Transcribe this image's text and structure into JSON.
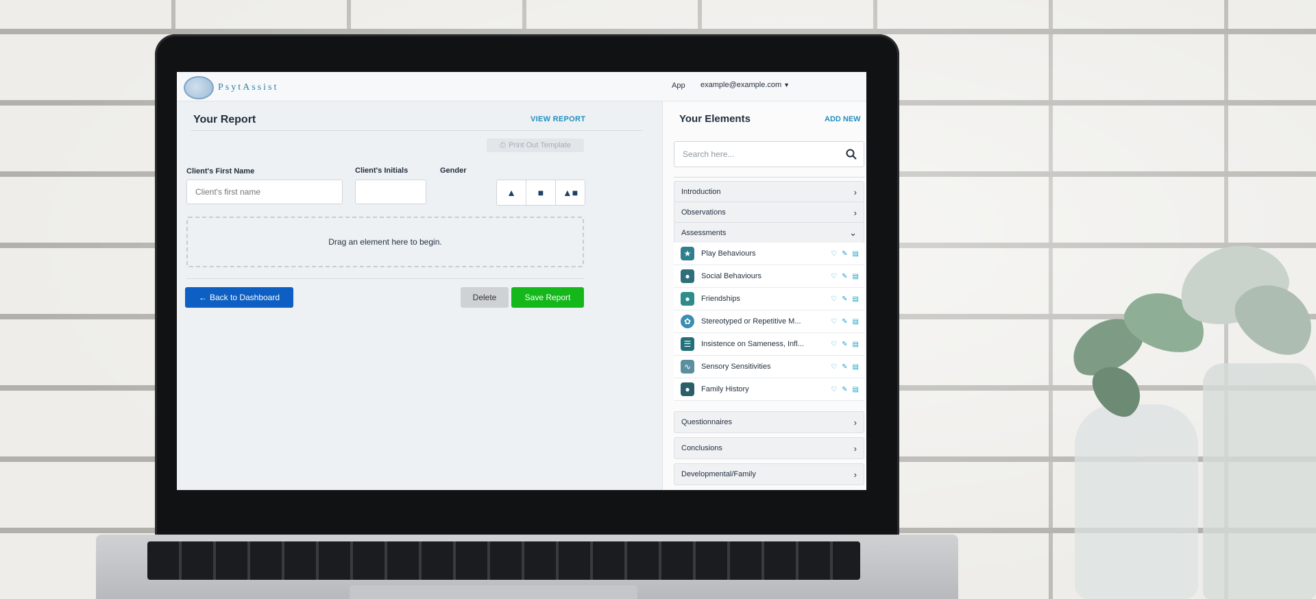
{
  "brand": {
    "name": "PsytAssist"
  },
  "topnav": {
    "app_label": "App",
    "user_email": "example@example.com"
  },
  "report": {
    "title": "Your Report",
    "view_link": "VIEW REPORT",
    "print_label": "Print Out Template",
    "first_name_label": "Client's First Name",
    "first_name_placeholder": "Client's first name",
    "first_name_value": "",
    "initials_label": "Client's Initials",
    "initials_value": "",
    "gender_label": "Gender",
    "gender_options": [
      "male",
      "female",
      "other"
    ],
    "dropzone_text": "Drag an element here to begin.",
    "back_label": "Back to Dashboard",
    "delete_label": "Delete",
    "save_label": "Save Report"
  },
  "elements": {
    "title": "Your Elements",
    "add_new": "ADD NEW",
    "search_placeholder": "Search here...",
    "sections": [
      {
        "label": "Introduction",
        "expanded": false
      },
      {
        "label": "Observations",
        "expanded": false
      },
      {
        "label": "Assessments",
        "expanded": true
      },
      {
        "label": "Questionnaires",
        "expanded": false
      },
      {
        "label": "Conclusions",
        "expanded": false
      },
      {
        "label": "Developmental/Family",
        "expanded": false
      }
    ],
    "assessment_items": [
      {
        "label": "Play Behaviours",
        "icon": "trophy-icon",
        "color": "#2f7f8f"
      },
      {
        "label": "Social Behaviours",
        "icon": "people-icon",
        "color": "#2d6f7a"
      },
      {
        "label": "Friendships",
        "icon": "friends-icon",
        "color": "#2e8c8c"
      },
      {
        "label": "Stereotyped or Repetitive M...",
        "icon": "brain-icon",
        "color": "#3a8fb0"
      },
      {
        "label": "Insistence on Sameness, Infl...",
        "icon": "notebook-icon",
        "color": "#24707a"
      },
      {
        "label": "Sensory Sensitivities",
        "icon": "ear-icon",
        "color": "#5a8fa0"
      },
      {
        "label": "Family History",
        "icon": "person-icon",
        "color": "#2a5f6a"
      }
    ]
  }
}
